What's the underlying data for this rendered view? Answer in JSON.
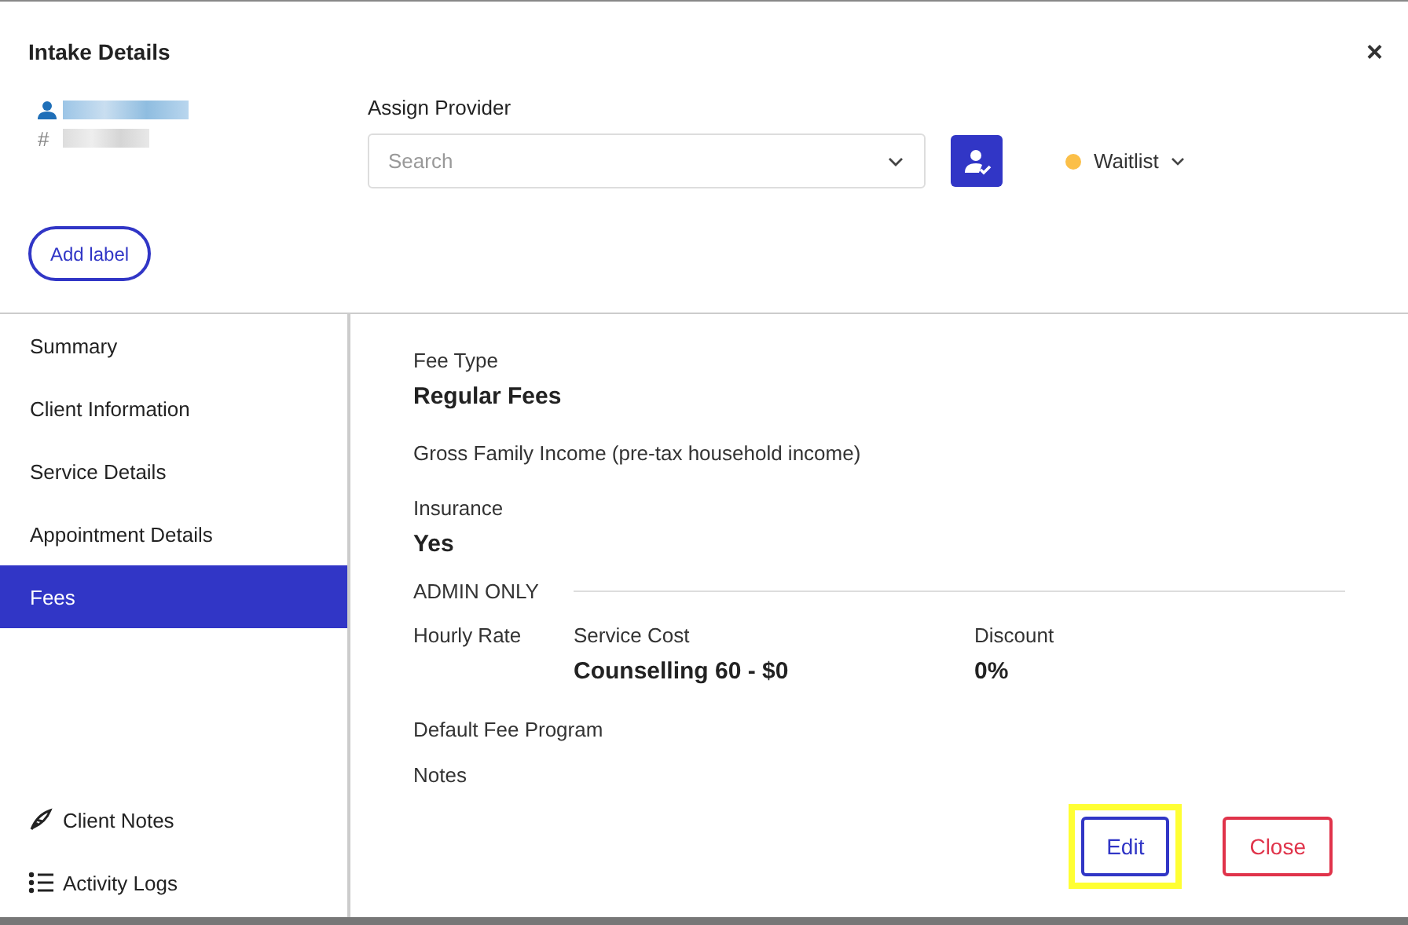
{
  "dialog": {
    "title": "Intake Details",
    "close_symbol": "×"
  },
  "client": {
    "id_symbol": "#"
  },
  "assign_provider": {
    "label": "Assign Provider",
    "placeholder": "Search"
  },
  "status": {
    "label": "Waitlist",
    "color": "#fbbf48"
  },
  "add_label_button": "Add label",
  "sidebar": {
    "items": [
      {
        "label": "Summary",
        "selected": false
      },
      {
        "label": "Client Information",
        "selected": false
      },
      {
        "label": "Service Details",
        "selected": false
      },
      {
        "label": "Appointment Details",
        "selected": false
      },
      {
        "label": "Fees",
        "selected": true
      }
    ],
    "footer_links": [
      {
        "kind": "notes",
        "label": "Client Notes"
      },
      {
        "kind": "logs",
        "label": "Activity Logs"
      }
    ]
  },
  "fees": {
    "fee_type": {
      "label": "Fee Type",
      "value": "Regular Fees"
    },
    "gross_income": {
      "label": "Gross Family Income (pre-tax household income)"
    },
    "insurance": {
      "label": "Insurance",
      "value": "Yes"
    },
    "admin_heading": "ADMIN ONLY",
    "hourly_rate": {
      "label": "Hourly Rate"
    },
    "service_cost": {
      "label": "Service Cost",
      "value": "Counselling 60 - $0"
    },
    "discount": {
      "label": "Discount",
      "value": "0%"
    },
    "default_fee_program": {
      "label": "Default Fee Program"
    },
    "notes": {
      "label": "Notes"
    }
  },
  "buttons": [
    {
      "kind": "primary",
      "label": "Edit",
      "highlighted": true
    },
    {
      "kind": "danger",
      "label": "Close",
      "highlighted": false
    }
  ]
}
